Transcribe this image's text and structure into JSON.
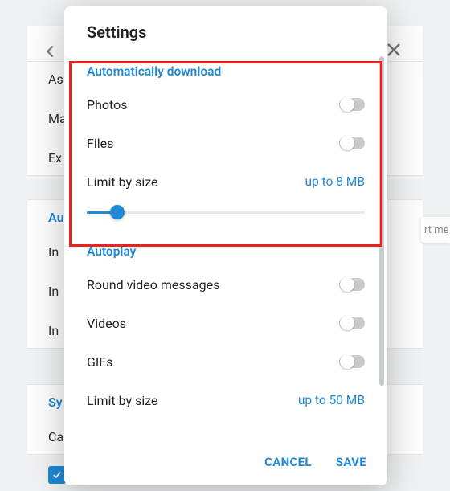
{
  "background": {
    "items1": [
      "As",
      "Ma",
      "Ex"
    ],
    "sec2_header": "Au",
    "items2": [
      "In",
      "In",
      "In"
    ],
    "sec3_header": "Sy",
    "items3": [
      "Ca"
    ],
    "right_btn": "rt me"
  },
  "modal": {
    "title": "Settings",
    "cancel": "CANCEL",
    "save": "SAVE",
    "auto_download": {
      "heading": "Automatically download",
      "photos": "Photos",
      "files": "Files",
      "limit_label": "Limit by size",
      "limit_value": "up to 8 MB",
      "slider_percent": 11
    },
    "autoplay": {
      "heading": "Autoplay",
      "round": "Round video messages",
      "videos": "Videos",
      "gifs": "GIFs",
      "limit_label": "Limit by size",
      "limit_value": "up to 50 MB"
    }
  }
}
